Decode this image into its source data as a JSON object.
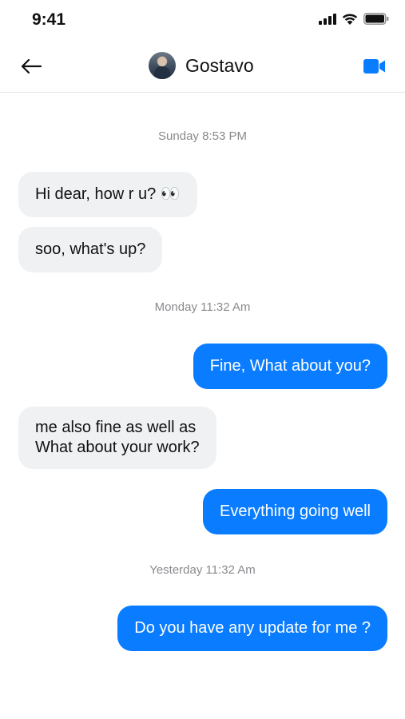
{
  "status_bar": {
    "time": "9:41"
  },
  "header": {
    "contact_name": "Gostavo"
  },
  "colors": {
    "accent": "#0a7cff",
    "incoming_bubble": "#f0f1f3"
  },
  "icons": [
    "back-arrow-icon",
    "avatar",
    "video-camera-icon",
    "signal-icon",
    "wifi-icon",
    "battery-icon"
  ],
  "conversation": {
    "timestamps": [
      "Sunday 8:53 PM",
      "Monday 11:32 Am",
      "Yesterday 11:32 Am"
    ],
    "messages": [
      {
        "direction": "incoming",
        "text": "Hi dear, how r u? 👀"
      },
      {
        "direction": "incoming",
        "text": "soo, what's up?"
      },
      {
        "direction": "outgoing",
        "text": "Fine, What about you?"
      },
      {
        "direction": "incoming",
        "line1": "me also fine as well as",
        "line2": "What about your work?"
      },
      {
        "direction": "outgoing",
        "text": "Everything going well"
      },
      {
        "direction": "outgoing",
        "text": "Do you have any update for me ?"
      }
    ]
  }
}
